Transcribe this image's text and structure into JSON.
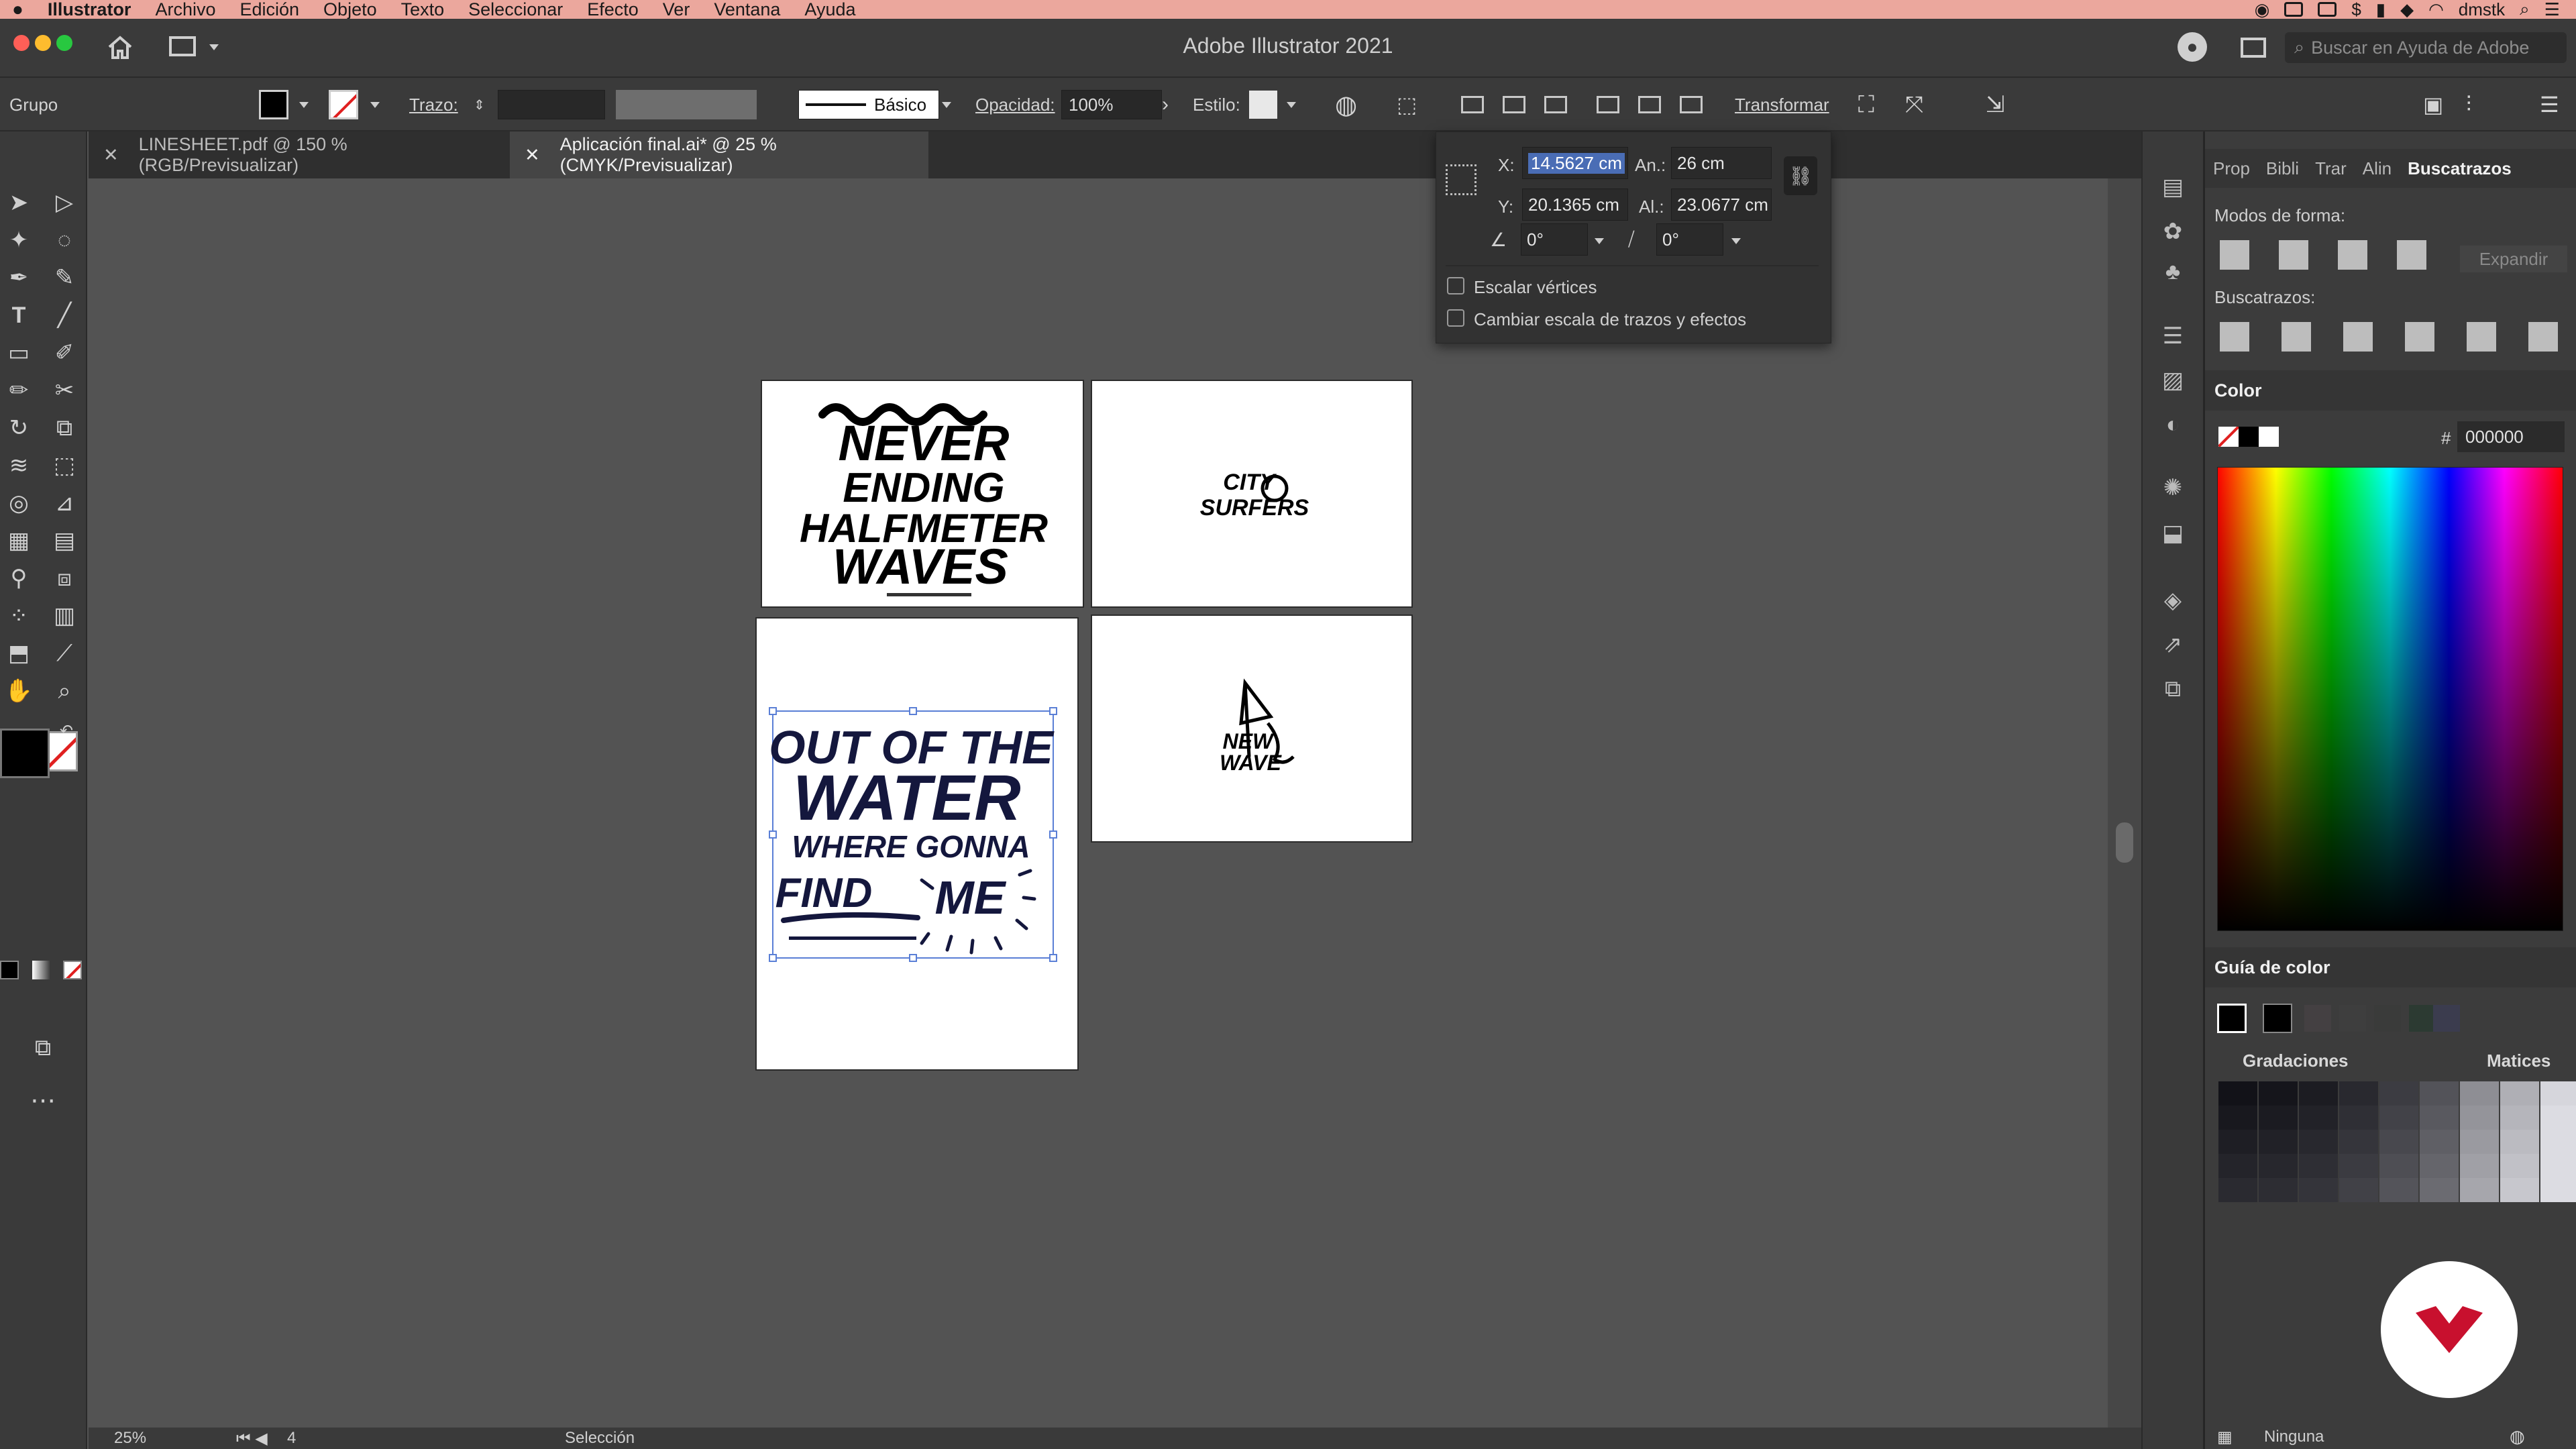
{
  "menubar": {
    "app": "Illustrator",
    "items": [
      "Archivo",
      "Edición",
      "Objeto",
      "Texto",
      "Seleccionar",
      "Efecto",
      "Ver",
      "Ventana",
      "Ayuda"
    ],
    "user": "dmstk"
  },
  "window": {
    "title": "Adobe Illustrator 2021",
    "search_placeholder": "Buscar en Ayuda de Adobe"
  },
  "controlbar": {
    "selection_type": "Grupo",
    "stroke_label": "Trazo:",
    "brush_label": "Básico",
    "opacity_label": "Opacidad:",
    "opacity_value": "100%",
    "style_label": "Estilo:",
    "transform_label": "Transformar"
  },
  "tabs": [
    {
      "label": "LINESHEET.pdf @ 150 % (RGB/Previsualizar)",
      "active": false
    },
    {
      "label": "Aplicación final.ai* @ 25 % (CMYK/Previsualizar)",
      "active": true
    }
  ],
  "transform": {
    "x_label": "X:",
    "x_value": "14.5627 cm",
    "y_label": "Y:",
    "y_value": "20.1365 cm",
    "w_label": "An.:",
    "w_value": "26 cm",
    "h_label": "Al.:",
    "h_value": "23.0677 cm",
    "rotate_value": "0°",
    "shear_value": "0°",
    "scale_corners": "Escalar vértices",
    "scale_strokes": "Cambiar escala de trazos y efectos"
  },
  "artwork": {
    "never_ending": [
      "NEVER",
      "ENDING",
      "HALFMETER",
      "WAVES"
    ],
    "city_surfers": [
      "CITY",
      "SURFERS"
    ],
    "out_of_water": [
      "OUT OF THE",
      "WATER",
      "WHERE GONNA",
      "FIND",
      "ME"
    ],
    "new_wave": [
      "NEW",
      "WAVE"
    ]
  },
  "panel": {
    "tabs": [
      "Prop",
      "Bibli",
      "Trar",
      "Alin",
      "Buscatrazos"
    ],
    "shape_modes_label": "Modos de forma:",
    "expand_label": "Expandir",
    "pathfinders_label": "Buscatrazos:",
    "color_header": "Color",
    "hex_label": "#",
    "hex_value": "000000",
    "guide_header": "Guía de color",
    "gradations_label": "Gradaciones",
    "tints_label": "Matices",
    "none_label": "Ninguna"
  },
  "status": {
    "zoom": "25%",
    "artboard_number": "4",
    "mode": "Selección"
  },
  "colors": {
    "menubar_bg": "#eba79d",
    "ui_dark": "#3a3a3a",
    "canvas": "#535353",
    "artwork_ink": "#14173d",
    "selection": "#5a7fd6",
    "brand_red": "#c8102e"
  }
}
